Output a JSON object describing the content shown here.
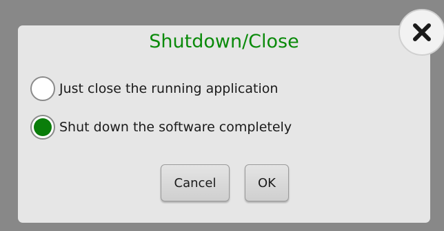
{
  "dialog": {
    "title": "Shutdown/Close",
    "options": [
      {
        "label": "Just close the running application",
        "selected": false
      },
      {
        "label": "Shut down the software completely",
        "selected": true
      }
    ],
    "cancel_label": "Cancel",
    "ok_label": "OK",
    "close_icon": "close-icon"
  },
  "colors": {
    "title": "#0a8a0a",
    "radio_selected": "#0a7d0a",
    "backdrop": "#888888",
    "dialog_background": "#e6e6e6"
  }
}
